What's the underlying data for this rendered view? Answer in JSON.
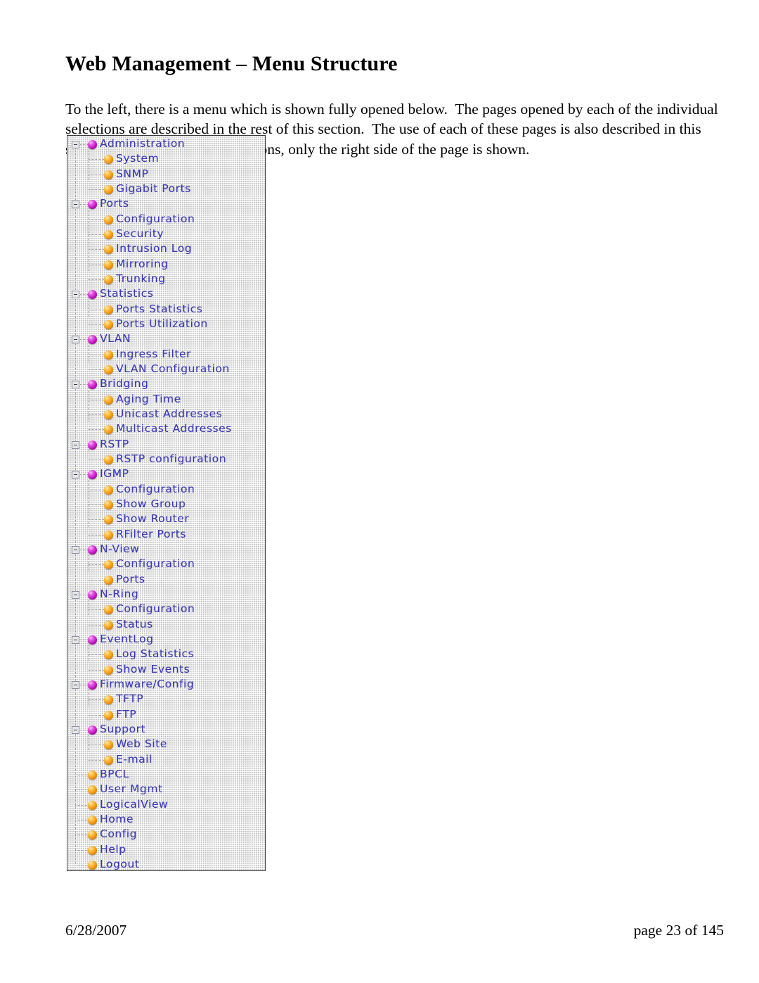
{
  "document": {
    "title": "Web Management – Menu Structure",
    "intro": "To the left, there is a menu which is shown fully opened below.  The pages opened by each of the individual selections are described in the rest of this section.  The use of each of these pages is also described in this section.  In most of the descriptions, only the right side of the page is shown."
  },
  "colors": {
    "link_text": "#3a38b4",
    "parent_bullet": "#bf11bf",
    "child_bullet": "#f0920c",
    "panel_border": "#3a3a3a",
    "panel_background": "#e2e2e2"
  },
  "menu": {
    "name": "web-management-menu",
    "expander_icon": "minus-box-icon",
    "parent_icon": "purple-sphere-icon",
    "child_icon": "orange-sphere-icon",
    "items": [
      {
        "label": "Administration",
        "level": 0,
        "type": "parent",
        "expanded": true
      },
      {
        "label": "System",
        "level": 1,
        "type": "child"
      },
      {
        "label": "SNMP",
        "level": 1,
        "type": "child"
      },
      {
        "label": "Gigabit Ports",
        "level": 1,
        "type": "child"
      },
      {
        "label": "Ports",
        "level": 0,
        "type": "parent",
        "expanded": true
      },
      {
        "label": "Configuration",
        "level": 1,
        "type": "child"
      },
      {
        "label": "Security",
        "level": 1,
        "type": "child"
      },
      {
        "label": "Intrusion Log",
        "level": 1,
        "type": "child"
      },
      {
        "label": "Mirroring",
        "level": 1,
        "type": "child"
      },
      {
        "label": "Trunking",
        "level": 1,
        "type": "child"
      },
      {
        "label": "Statistics",
        "level": 0,
        "type": "parent",
        "expanded": true
      },
      {
        "label": "Ports Statistics",
        "level": 1,
        "type": "child"
      },
      {
        "label": "Ports Utilization",
        "level": 1,
        "type": "child"
      },
      {
        "label": "VLAN",
        "level": 0,
        "type": "parent",
        "expanded": true
      },
      {
        "label": "Ingress Filter",
        "level": 1,
        "type": "child"
      },
      {
        "label": "VLAN Configuration",
        "level": 1,
        "type": "child"
      },
      {
        "label": "Bridging",
        "level": 0,
        "type": "parent",
        "expanded": true
      },
      {
        "label": "Aging Time",
        "level": 1,
        "type": "child"
      },
      {
        "label": "Unicast Addresses",
        "level": 1,
        "type": "child"
      },
      {
        "label": "Multicast Addresses",
        "level": 1,
        "type": "child"
      },
      {
        "label": "RSTP",
        "level": 0,
        "type": "parent",
        "expanded": true
      },
      {
        "label": "RSTP configuration",
        "level": 1,
        "type": "child"
      },
      {
        "label": "IGMP",
        "level": 0,
        "type": "parent",
        "expanded": true
      },
      {
        "label": "Configuration",
        "level": 1,
        "type": "child"
      },
      {
        "label": "Show Group",
        "level": 1,
        "type": "child"
      },
      {
        "label": "Show Router",
        "level": 1,
        "type": "child"
      },
      {
        "label": "RFilter Ports",
        "level": 1,
        "type": "child"
      },
      {
        "label": "N-View",
        "level": 0,
        "type": "parent",
        "expanded": true
      },
      {
        "label": "Configuration",
        "level": 1,
        "type": "child"
      },
      {
        "label": "Ports",
        "level": 1,
        "type": "child"
      },
      {
        "label": "N-Ring",
        "level": 0,
        "type": "parent",
        "expanded": true
      },
      {
        "label": "Configuration",
        "level": 1,
        "type": "child"
      },
      {
        "label": "Status",
        "level": 1,
        "type": "child"
      },
      {
        "label": "EventLog",
        "level": 0,
        "type": "parent",
        "expanded": true
      },
      {
        "label": "Log Statistics",
        "level": 1,
        "type": "child"
      },
      {
        "label": "Show Events",
        "level": 1,
        "type": "child"
      },
      {
        "label": "Firmware/Config",
        "level": 0,
        "type": "parent",
        "expanded": true
      },
      {
        "label": "TFTP",
        "level": 1,
        "type": "child"
      },
      {
        "label": "FTP",
        "level": 1,
        "type": "child"
      },
      {
        "label": "Support",
        "level": 0,
        "type": "parent",
        "expanded": true
      },
      {
        "label": "Web Site",
        "level": 1,
        "type": "child"
      },
      {
        "label": "E-mail",
        "level": 1,
        "type": "child"
      },
      {
        "label": "BPCL",
        "level": 0,
        "type": "leaf"
      },
      {
        "label": "User Mgmt",
        "level": 0,
        "type": "leaf"
      },
      {
        "label": "LogicalView",
        "level": 0,
        "type": "leaf"
      },
      {
        "label": "Home",
        "level": 0,
        "type": "leaf"
      },
      {
        "label": "Config",
        "level": 0,
        "type": "leaf"
      },
      {
        "label": "Help",
        "level": 0,
        "type": "leaf"
      },
      {
        "label": "Logout",
        "level": 0,
        "type": "leaf"
      }
    ]
  },
  "footer": {
    "date": "6/28/2007",
    "page": "page 23 of 145"
  }
}
